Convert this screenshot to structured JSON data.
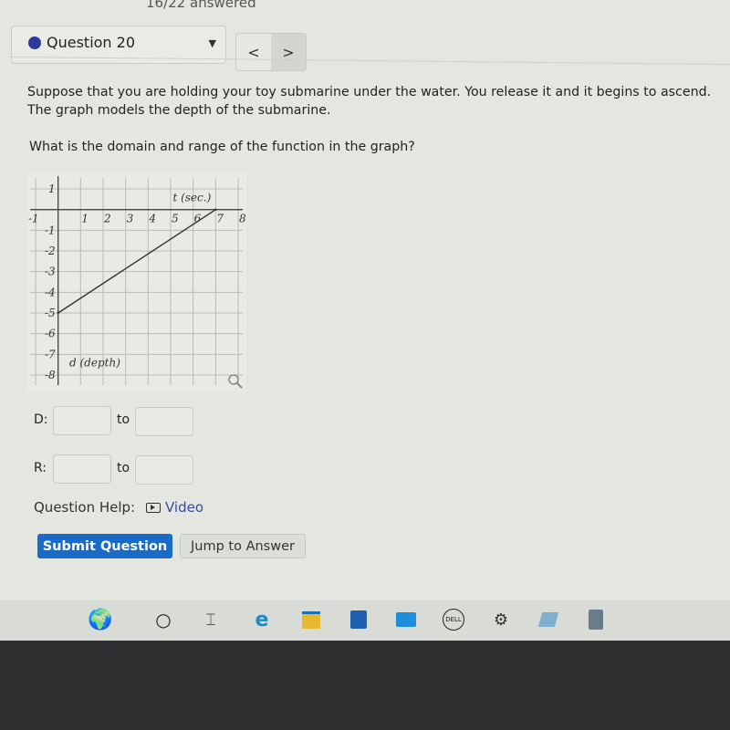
{
  "header": {
    "answered": "16/22 answered"
  },
  "question_nav": {
    "selected": "Question 20",
    "prev_label": "<",
    "next_label": ">",
    "status_color": "#2e3a9e"
  },
  "question": {
    "line1": "Suppose that you are holding your toy submarine under the water. You release it and it begins to ascend.",
    "line2": "The graph models the depth of the submarine.",
    "prompt": "What is the domain and range of the function in the graph?"
  },
  "chart_data": {
    "type": "line",
    "xlabel": "t (sec.)",
    "ylabel": "d (depth)",
    "xlim": [
      -1,
      8
    ],
    "ylim": [
      -8,
      1
    ],
    "grid": true,
    "x_ticks": [
      "-1",
      "1",
      "2",
      "3",
      "4",
      "5",
      "6",
      "7",
      "8"
    ],
    "y_ticks": [
      "1",
      "-1",
      "-2",
      "-3",
      "-4",
      "-5",
      "-6",
      "-7",
      "-8"
    ],
    "series": [
      {
        "points": [
          [
            0,
            -5
          ],
          [
            7,
            0
          ]
        ]
      }
    ]
  },
  "answers": {
    "domain_label": "D:",
    "range_label": "R:",
    "to": "to",
    "domain_from": "",
    "domain_to": "",
    "range_from": "",
    "range_to": ""
  },
  "help": {
    "label": "Question Help:",
    "video": "Video"
  },
  "buttons": {
    "submit": "Submit Question",
    "jump": "Jump to Answer"
  },
  "taskbar": {
    "icons": [
      "widgets-icon",
      "search-icon",
      "task-view-icon",
      "edge-icon",
      "file-explorer-icon",
      "store-icon",
      "mail-icon",
      "dell-icon",
      "settings-icon",
      "notepad-icon",
      "calculator-icon"
    ]
  }
}
